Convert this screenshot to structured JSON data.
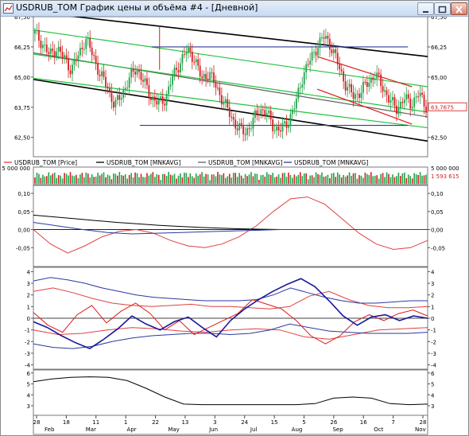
{
  "window": {
    "title": "USDRUB_TOM График цены и объёма #4 - [Дневной]",
    "icon": "chart-app-icon",
    "buttons": [
      "minimize-icon",
      "maximize-icon",
      "close-icon"
    ]
  },
  "chart_data": [
    {
      "panel": "price",
      "type": "candlestick",
      "ylim": [
        61.7,
        67.5
      ],
      "yticks": [
        "67,50",
        "66,25",
        "65,00",
        "63,75",
        "62,50"
      ],
      "last_value": 63.7675,
      "last_label": "63,7675",
      "trend_lines": [
        {
          "color": "#000000",
          "from": [
            0,
            67.7
          ],
          "to": [
            1,
            65.85
          ]
        },
        {
          "color": "#000000",
          "from": [
            0,
            64.9
          ],
          "to": [
            1,
            62.35
          ]
        },
        {
          "color": "#606060",
          "from": [
            0,
            66.0
          ],
          "to": [
            1,
            63.35
          ]
        },
        {
          "color": "#22c23c",
          "from": [
            0,
            66.95
          ],
          "to": [
            1,
            64.6
          ]
        },
        {
          "color": "#22c23c",
          "from": [
            0,
            65.95
          ],
          "to": [
            1,
            63.55
          ]
        },
        {
          "color": "#22c23c",
          "from": [
            0,
            64.95
          ],
          "to": [
            1,
            62.9
          ]
        },
        {
          "color": "#2a3a9e",
          "from": [
            0.3,
            66.25
          ],
          "to": [
            0.95,
            66.25
          ]
        },
        {
          "color": "#2a3a9e",
          "from": [
            0.27,
            63.0
          ],
          "to": [
            0.95,
            63.0
          ]
        },
        {
          "color": "#e01818",
          "from": [
            0.72,
            65.85
          ],
          "to": [
            0.96,
            64.6
          ]
        },
        {
          "color": "#e01818",
          "from": [
            0.72,
            64.5
          ],
          "to": [
            0.96,
            63.05
          ]
        }
      ],
      "legend": [
        {
          "name": "USDRUB_TOM [Price]",
          "color": "#e04040"
        },
        {
          "name": "USDRUB_TOM [MNKAVG]",
          "color": "#000000"
        },
        {
          "name": "USDRUB_TOM [MNKAVG]",
          "color": "#606060"
        },
        {
          "name": "USDRUB_TOM [MNKAVG]",
          "color": "#2a3a9e"
        }
      ],
      "close_path": [
        66.8,
        66.4,
        65.9,
        66.2,
        65.8,
        65.3,
        65.9,
        66.6,
        65.9,
        65.1,
        64.6,
        63.8,
        64.3,
        64.9,
        65.4,
        64.8,
        64.2,
        63.9,
        64.1,
        65.0,
        65.6,
        66.1,
        65.8,
        64.9,
        65.2,
        64.6,
        64.0,
        63.4,
        62.9,
        62.7,
        63.1,
        63.7,
        63.5,
        62.9,
        62.8,
        63.2,
        63.9,
        65.1,
        65.7,
        66.3,
        66.7,
        66.2,
        65.4,
        64.6,
        64.2,
        64.4,
        64.8,
        65.1,
        64.6,
        64.0,
        63.7,
        64.1,
        63.9,
        64.3,
        63.8
      ]
    },
    {
      "panel": "volume",
      "type": "bar",
      "ylim": [
        0,
        5000000
      ],
      "ytick_label": "5 000 000",
      "last_label": "1 593 615"
    },
    {
      "panel": "oscillator-1",
      "type": "line",
      "ylim": [
        -0.1,
        0.12
      ],
      "yticks": [
        "0,10",
        "0,05",
        "0,00",
        "-0,05"
      ],
      "series": [
        {
          "color": "#e04040",
          "values": [
            0.0,
            -0.04,
            -0.065,
            -0.045,
            -0.02,
            -0.005,
            0.0,
            -0.01,
            -0.03,
            -0.045,
            -0.05,
            -0.04,
            -0.02,
            0.01,
            0.05,
            0.085,
            0.09,
            0.07,
            0.03,
            -0.01,
            -0.04,
            -0.055,
            -0.05,
            -0.03
          ]
        },
        {
          "color": "#000000",
          "values": [
            0.04,
            0.035,
            0.03,
            0.025,
            0.02,
            0.016,
            0.012,
            0.009,
            0.006,
            0.004,
            0.002,
            0.001,
            0.0,
            0.0,
            0.0,
            0.0,
            0.0,
            0.0,
            0.0,
            0.0
          ]
        },
        {
          "color": "#2a3a9e",
          "values": [
            0.02,
            0.01,
            0.0,
            -0.008,
            -0.012,
            -0.01,
            -0.008,
            -0.006,
            -0.004,
            -0.002,
            0.0,
            0.0,
            0.0,
            0.0,
            0.0,
            0.0,
            0.0
          ]
        }
      ]
    },
    {
      "panel": "oscillator-2",
      "type": "line",
      "ylim": [
        -4.3,
        4.3
      ],
      "yticks": [
        "4",
        "3",
        "2",
        "1",
        "0",
        "-1",
        "-2",
        "-3",
        "-4"
      ],
      "series": [
        {
          "color": "#1a1a9c",
          "values": [
            -0.3,
            -0.8,
            -1.5,
            -2.1,
            -2.6,
            -1.8,
            -0.9,
            0.2,
            -0.5,
            -1.0,
            -0.3,
            0.1,
            -0.8,
            -1.6,
            -0.2,
            0.8,
            1.6,
            2.3,
            2.9,
            3.4,
            2.7,
            1.5,
            0.2,
            -0.6,
            0.1,
            0.3,
            -0.2,
            0.2,
            0.0
          ]
        },
        {
          "color": "#e01818",
          "values": [
            0.5,
            -0.6,
            -1.2,
            0.3,
            1.1,
            -0.4,
            0.6,
            1.3,
            0.4,
            -1.0,
            -0.2,
            -1.4,
            -0.8,
            -0.2,
            0.4,
            1.6,
            1.2,
            0.8,
            -0.2,
            -1.5,
            -2.2,
            -1.5,
            -0.3,
            0.3,
            -0.2,
            0.4,
            0.7,
            0.2
          ]
        },
        {
          "color": "#2a3a9e",
          "values": [
            3.2,
            3.5,
            3.3,
            3.0,
            2.6,
            2.3,
            2.0,
            1.8,
            1.7,
            1.6,
            1.5,
            1.5,
            1.5,
            1.6,
            2.0,
            2.6,
            2.2,
            1.8,
            1.5,
            1.3,
            1.3,
            1.4,
            1.5,
            1.5
          ]
        },
        {
          "color": "#2a3a9e",
          "values": [
            -2.2,
            -2.5,
            -2.6,
            -2.4,
            -2.0,
            -1.7,
            -1.5,
            -1.4,
            -1.3,
            -1.3,
            -1.4,
            -1.3,
            -1.0,
            -0.5,
            -0.8,
            -1.1,
            -1.2,
            -1.3,
            -1.3,
            -1.3,
            -1.2
          ]
        },
        {
          "color": "#e04040",
          "values": [
            2.3,
            2.6,
            2.2,
            1.7,
            1.3,
            1.1,
            1.0,
            1.1,
            1.2,
            1.0,
            1.0,
            0.9,
            0.8,
            1.0,
            1.9,
            2.3,
            1.6,
            1.1,
            0.9,
            0.9,
            1.0
          ]
        },
        {
          "color": "#e04040",
          "values": [
            -1.0,
            -1.4,
            -1.3,
            -1.0,
            -0.8,
            -0.9,
            -1.1,
            -1.2,
            -1.0,
            -0.9,
            -1.0,
            -1.6,
            -1.8,
            -1.4,
            -1.0,
            -0.9,
            -0.8
          ]
        }
      ]
    },
    {
      "panel": "oscillator-3",
      "type": "line",
      "ylim": [
        2.2,
        6.2
      ],
      "yticks": [
        "6",
        "5",
        "4",
        "3"
      ],
      "series": [
        {
          "color": "#000000",
          "values": [
            5.2,
            5.45,
            5.6,
            5.65,
            5.6,
            5.3,
            4.6,
            3.8,
            3.15,
            3.1,
            3.1,
            3.1,
            3.1,
            3.1,
            3.1,
            3.2,
            3.7,
            3.8,
            3.7,
            3.2,
            3.1,
            3.15
          ]
        }
      ]
    }
  ],
  "x_axis": {
    "day_ticks": [
      "28",
      "18",
      "11",
      "1",
      "22",
      "13",
      "3",
      "24",
      "15",
      "5",
      "26",
      "16",
      "7",
      "28"
    ],
    "months": [
      "Feb",
      "Mar",
      "Apr",
      "May",
      "Jun",
      "Jul",
      "Aug",
      "Sep",
      "Oct",
      "Nov"
    ]
  }
}
